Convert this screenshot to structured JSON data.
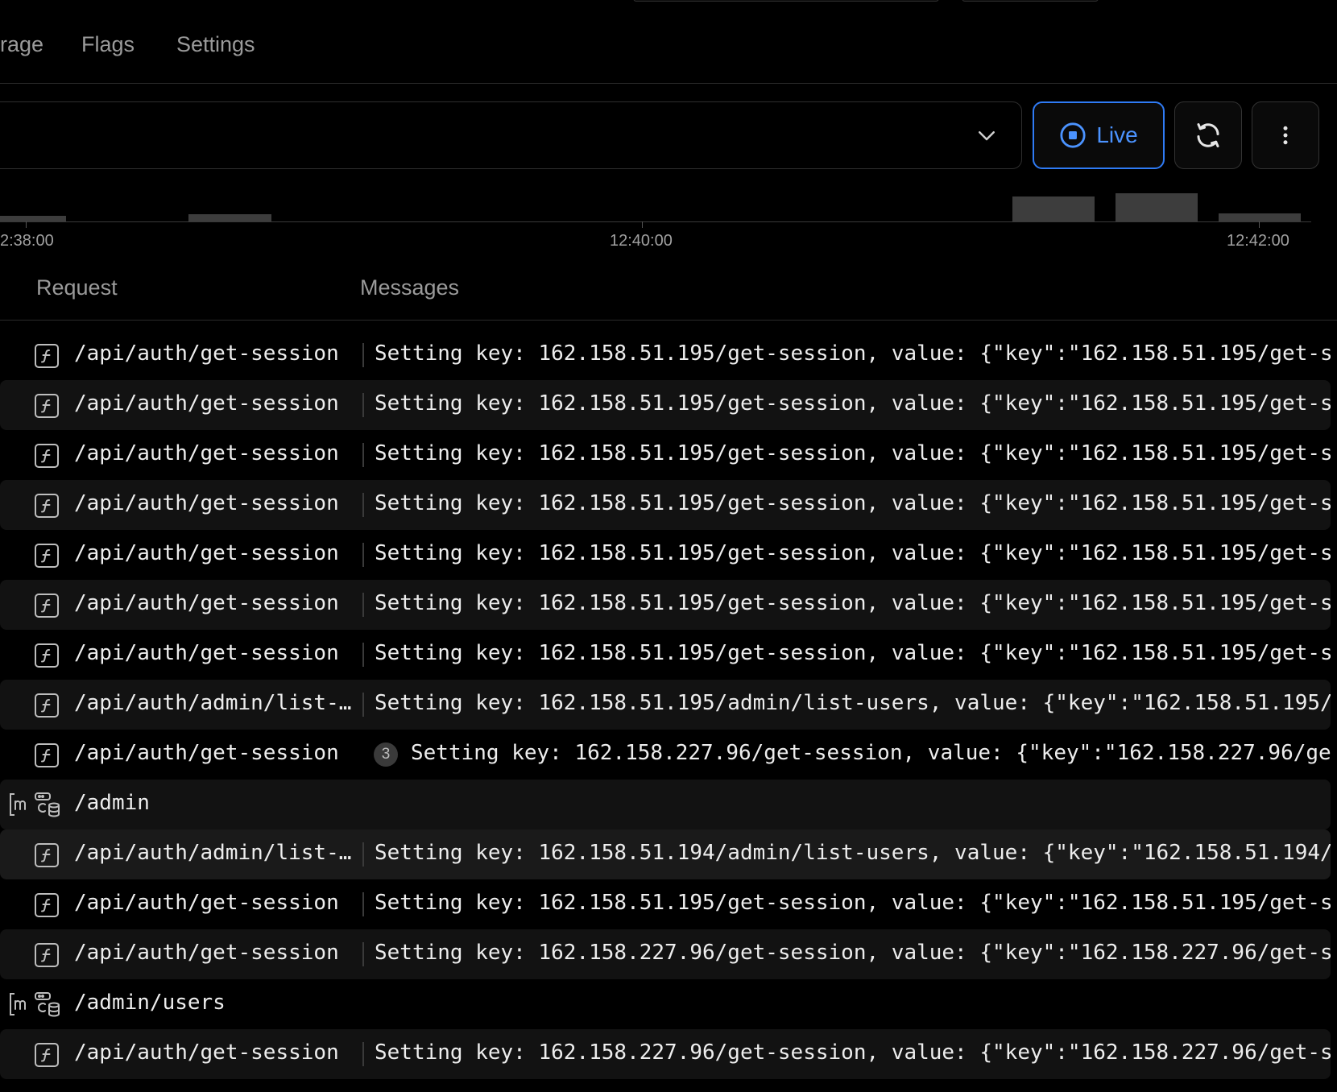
{
  "tabs": [
    "rage",
    "Flags",
    "Settings"
  ],
  "toolbar": {
    "live_label": "Live",
    "accent_color": "#2f7bf5"
  },
  "histogram": {
    "tick_labels": [
      "2:38:00",
      "12:40:00",
      "12:42:00"
    ]
  },
  "columns": {
    "request": "Request",
    "messages": "Messages"
  },
  "rows": [
    {
      "type": "log",
      "request": "/api/auth/get-session",
      "message": "Setting key: 162.158.51.195/get-session, value: {\"key\":\"162.158.51.195/get-s"
    },
    {
      "type": "log",
      "request": "/api/auth/get-session",
      "message": "Setting key: 162.158.51.195/get-session, value: {\"key\":\"162.158.51.195/get-s"
    },
    {
      "type": "log",
      "request": "/api/auth/get-session",
      "message": "Setting key: 162.158.51.195/get-session, value: {\"key\":\"162.158.51.195/get-s"
    },
    {
      "type": "log",
      "request": "/api/auth/get-session",
      "message": "Setting key: 162.158.51.195/get-session, value: {\"key\":\"162.158.51.195/get-s"
    },
    {
      "type": "log",
      "request": "/api/auth/get-session",
      "message": "Setting key: 162.158.51.195/get-session, value: {\"key\":\"162.158.51.195/get-s"
    },
    {
      "type": "log",
      "request": "/api/auth/get-session",
      "message": "Setting key: 162.158.51.195/get-session, value: {\"key\":\"162.158.51.195/get-s"
    },
    {
      "type": "log",
      "request": "/api/auth/get-session",
      "message": "Setting key: 162.158.51.195/get-session, value: {\"key\":\"162.158.51.195/get-s"
    },
    {
      "type": "log",
      "request": "/api/auth/admin/list-…",
      "message": "Setting key: 162.158.51.195/admin/list-users, value: {\"key\":\"162.158.51.195/"
    },
    {
      "type": "log",
      "request": "/api/auth/get-session",
      "badge": "3",
      "message": "Setting key: 162.158.227.96/get-session, value: {\"key\":\"162.158.227.96/ge"
    },
    {
      "type": "page",
      "request": "/admin"
    },
    {
      "type": "log",
      "request": "/api/auth/admin/list-…",
      "message": "Setting key: 162.158.51.194/admin/list-users, value: {\"key\":\"162.158.51.194/"
    },
    {
      "type": "log",
      "request": "/api/auth/get-session",
      "message": "Setting key: 162.158.51.195/get-session, value: {\"key\":\"162.158.51.195/get-s"
    },
    {
      "type": "log",
      "request": "/api/auth/get-session",
      "message": "Setting key: 162.158.227.96/get-session, value: {\"key\":\"162.158.227.96/get-s"
    },
    {
      "type": "page",
      "request": "/admin/users"
    },
    {
      "type": "log",
      "request": "/api/auth/get-session",
      "message": "Setting key: 162.158.227.96/get-session, value: {\"key\":\"162.158.227.96/get-s"
    }
  ]
}
